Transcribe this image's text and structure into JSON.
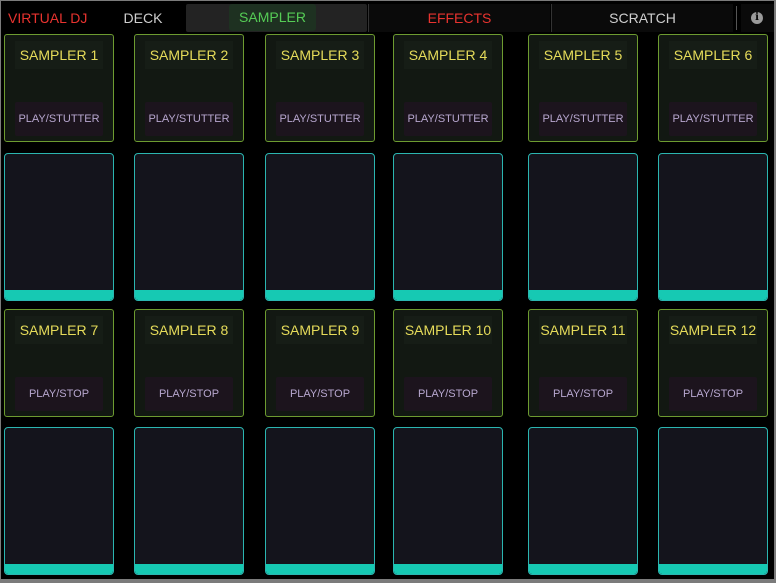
{
  "topbar": {
    "title": "VIRTUAL DJ",
    "tabs": {
      "deck": "DECK",
      "sampler": "SAMPLER",
      "effects": "EFFECTS",
      "scratch": "SCRATCH"
    },
    "info_icon": "info-icon"
  },
  "colors": {
    "title": "#e8332f",
    "active_tab": "#55cc55",
    "sampler_name": "#e6dc5a",
    "card_border": "#6d9b30",
    "pad_border": "#2bb5b0",
    "pad_level": "#16c9b3"
  },
  "samplers": [
    {
      "name": "SAMPLER 1",
      "mode": "PLAY/STUTTER"
    },
    {
      "name": "SAMPLER 2",
      "mode": "PLAY/STUTTER"
    },
    {
      "name": "SAMPLER 3",
      "mode": "PLAY/STUTTER"
    },
    {
      "name": "SAMPLER 4",
      "mode": "PLAY/STUTTER"
    },
    {
      "name": "SAMPLER 5",
      "mode": "PLAY/STUTTER"
    },
    {
      "name": "SAMPLER 6",
      "mode": "PLAY/STUTTER"
    },
    {
      "name": "SAMPLER 7",
      "mode": "PLAY/STOP"
    },
    {
      "name": "SAMPLER 8",
      "mode": "PLAY/STOP"
    },
    {
      "name": "SAMPLER 9",
      "mode": "PLAY/STOP"
    },
    {
      "name": "SAMPLER 10",
      "mode": "PLAY/STOP"
    },
    {
      "name": "SAMPLER 11",
      "mode": "PLAY/STOP"
    },
    {
      "name": "SAMPLER 12",
      "mode": "PLAY/STOP"
    }
  ]
}
